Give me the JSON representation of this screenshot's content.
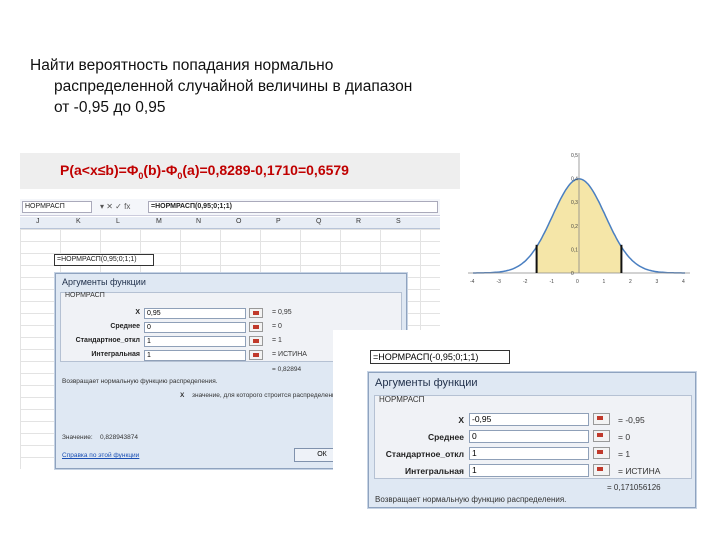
{
  "problem": {
    "line1": "Найти вероятность попадания нормально",
    "line2": "распределенной случайной величины в диапазон",
    "line3": "от -0,95 до 0,95"
  },
  "formula": {
    "p_part": "P(a<x≤b)=Φ",
    "sub0": "0",
    "mid": "(b)-Φ",
    "sub1": "0",
    "end": "(a)=0,8289-0,1710=0,6579"
  },
  "excel": {
    "namebox": "НОРМРАСП",
    "formula_bar": "=НОРМРАСП(0,95;0;1;1)",
    "columns": [
      "J",
      "K",
      "L",
      "M",
      "N",
      "O",
      "P",
      "Q",
      "R",
      "S"
    ],
    "cell_formula": "=НОРМРАСП(0,95;0;1;1)"
  },
  "dialog1": {
    "title": "Аргументы функции",
    "group": "НОРМРАСП",
    "rows": [
      {
        "label": "X",
        "value": "0,95",
        "result": "= 0,95"
      },
      {
        "label": "Среднее",
        "value": "0",
        "result": "= 0"
      },
      {
        "label": "Стандартное_откл",
        "value": "1",
        "result": "= 1"
      },
      {
        "label": "Интегральная",
        "value": "1",
        "result": "= ИСТИНА"
      }
    ],
    "result_line": "= 0,82894",
    "description": "Возвращает нормальную функцию распределения.",
    "x_note_label": "X",
    "x_note": "значение, для которого строится распределение.",
    "value_label": "Значение:",
    "value": "0,828943874",
    "help_link": "Справка по этой функции",
    "ok": "ОК"
  },
  "dialog2": {
    "formula": "=НОРМРАСП(-0,95;0;1;1)",
    "title": "Аргументы функции",
    "group": "НОРМРАСП",
    "rows": [
      {
        "label": "X",
        "value": "-0,95",
        "result": "= -0,95"
      },
      {
        "label": "Среднее",
        "value": "0",
        "result": "= 0"
      },
      {
        "label": "Стандартное_откл",
        "value": "1",
        "result": "= 1"
      },
      {
        "label": "Интегральная",
        "value": "1",
        "result": "= ИСТИНА"
      }
    ],
    "result_line": "= 0,171056126",
    "description": "Возвращает нормальную функцию распределения."
  },
  "chart": {
    "y_ticks": [
      "0,5",
      "0,4",
      "0,3",
      "0,2",
      "0,1",
      "0"
    ],
    "x_ticks": [
      "-4",
      "-3",
      "-2",
      "-1",
      "0",
      "1",
      "2",
      "3",
      "4"
    ],
    "fill_color": "#f5e6a8",
    "line_color": "#4a7fc1"
  }
}
